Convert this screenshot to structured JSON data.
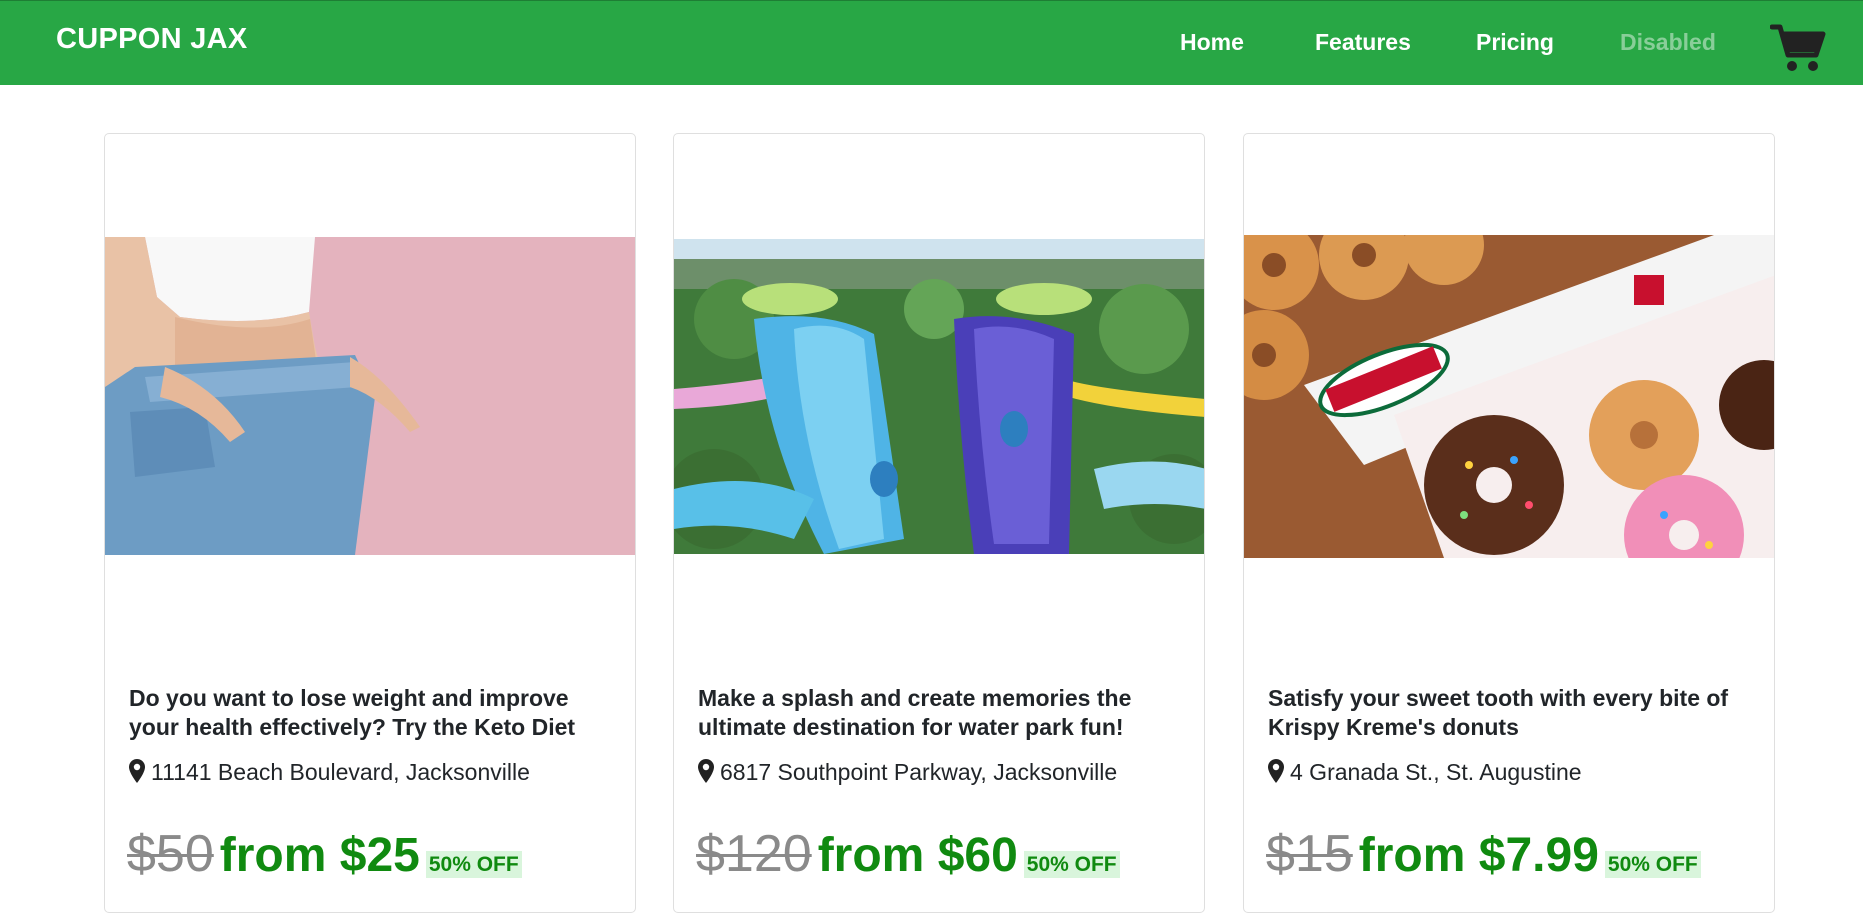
{
  "navbar": {
    "brand": "CUPPON JAX",
    "links": [
      {
        "label": "Home",
        "disabled": false
      },
      {
        "label": "Features",
        "disabled": false
      },
      {
        "label": "Pricing",
        "disabled": false
      },
      {
        "label": "Disabled",
        "disabled": true
      }
    ],
    "cart_icon": "shopping-cart-icon",
    "background_color": "#28a745"
  },
  "cards": [
    {
      "image": "woman-weight-loss-jeans-photo",
      "title": "Do you want to lose weight and improve your health effectively? Try the Keto Diet",
      "location": "11141 Beach Boulevard, Jacksonville",
      "old_price": "$50",
      "new_price": "from $25",
      "discount": "50% OFF"
    },
    {
      "image": "water-park-slides-photo",
      "title": "Make a splash and create memories the ultimate destination for water park fun!",
      "location": "6817 Southpoint Parkway, Jacksonville",
      "old_price": "$120",
      "new_price": "from $60",
      "discount": "50% OFF"
    },
    {
      "image": "krispy-kreme-donuts-photo",
      "title": "Satisfy your sweet tooth with every bite of Krispy Kreme's donuts",
      "location": "4 Granada St., St. Augustine",
      "old_price": "$15",
      "new_price": "from $7.99",
      "discount": "50% OFF"
    }
  ],
  "colors": {
    "price_green": "#108a10",
    "old_price_gray": "#8a8a8a",
    "discount_bg": "#d9f5dc"
  },
  "image_logo_text": "Krispy Kreme"
}
